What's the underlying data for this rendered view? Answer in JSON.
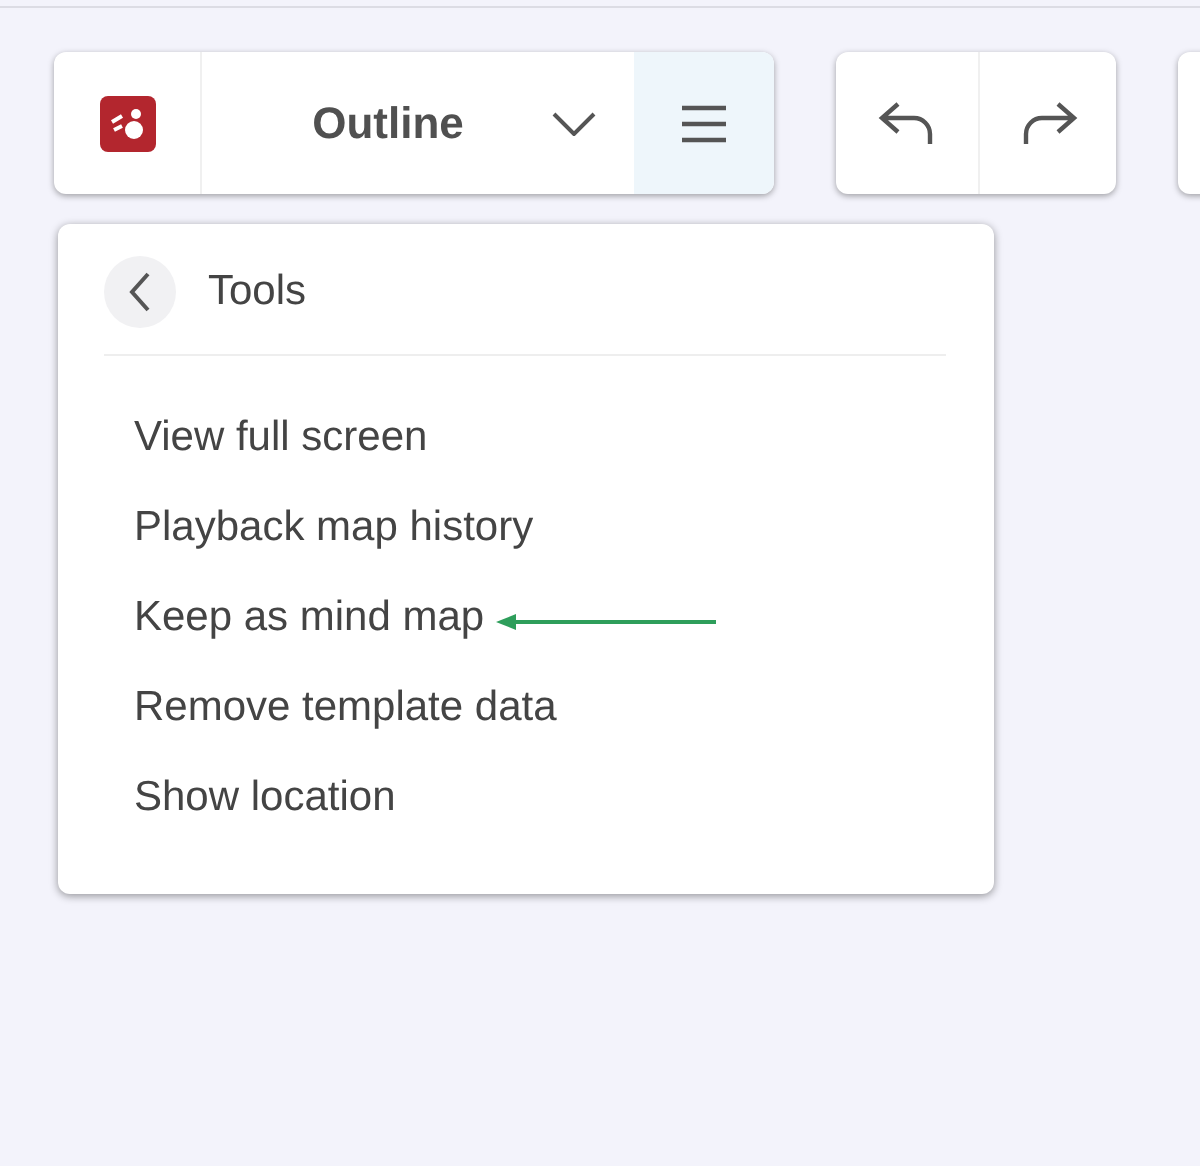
{
  "toolbar": {
    "title": "Outline",
    "menu_button": {
      "selected": true
    }
  },
  "menu": {
    "title": "Tools",
    "items": [
      {
        "label": "View full screen",
        "pointed": false
      },
      {
        "label": "Playback map history",
        "pointed": false
      },
      {
        "label": "Keep as mind map",
        "pointed": true
      },
      {
        "label": "Remove template data",
        "pointed": false
      },
      {
        "label": "Show location",
        "pointed": false
      }
    ]
  }
}
